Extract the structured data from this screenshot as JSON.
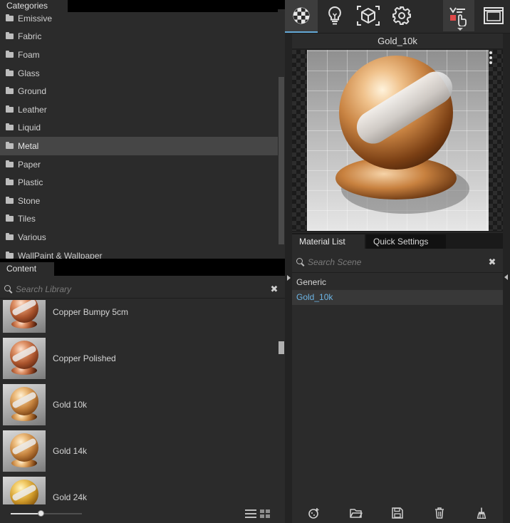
{
  "left": {
    "categories_title": "Categories",
    "categories": [
      {
        "label": "Emissive"
      },
      {
        "label": "Fabric"
      },
      {
        "label": "Foam"
      },
      {
        "label": "Glass"
      },
      {
        "label": "Ground"
      },
      {
        "label": "Leather"
      },
      {
        "label": "Liquid"
      },
      {
        "label": "Metal",
        "selected": true
      },
      {
        "label": "Paper"
      },
      {
        "label": "Plastic"
      },
      {
        "label": "Stone"
      },
      {
        "label": "Tiles"
      },
      {
        "label": "Various"
      },
      {
        "label": "WallPaint & Wallpaper"
      }
    ],
    "content_title": "Content",
    "search_placeholder": "Search Library",
    "clear_symbol": "✖",
    "materials": [
      {
        "label": "Copper Bumpy 5cm",
        "tone": "copper"
      },
      {
        "label": "Copper Polished",
        "tone": "copper"
      },
      {
        "label": "Gold 10k",
        "tone": "gold"
      },
      {
        "label": "Gold 14k",
        "tone": "gold"
      },
      {
        "label": "Gold 24k",
        "tone": "gold24"
      }
    ],
    "thumbnail_zoom": 0.42
  },
  "toolbar": {
    "icons": [
      "materials-icon",
      "lights-icon",
      "geometry-icon",
      "settings-icon",
      "render-interactive-icon",
      "frame-buffer-icon"
    ],
    "accent": "#64a8d6",
    "render_dot_color": "#e04a4a"
  },
  "right": {
    "preview_title": "Gold_10k",
    "tabs": [
      {
        "label": "Material List",
        "active": true
      },
      {
        "label": "Quick Settings",
        "active": false
      }
    ],
    "search_placeholder": "Search Scene",
    "clear_symbol": "✖",
    "tree": [
      {
        "label": "Generic",
        "type": "group"
      },
      {
        "label": "Gold_10k",
        "type": "item",
        "selected": true
      }
    ],
    "selected_color": "#6cb4e4"
  }
}
